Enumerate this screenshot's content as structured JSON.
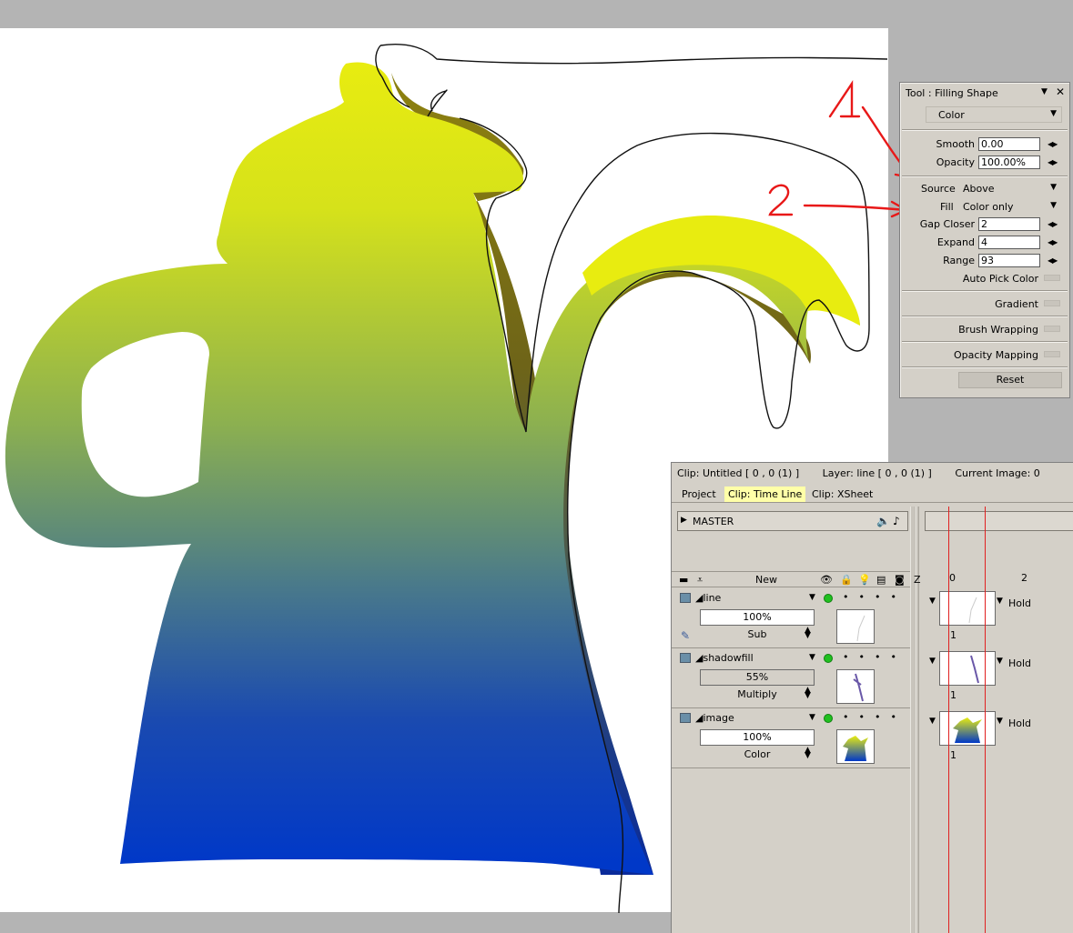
{
  "tool_panel": {
    "title": "Tool : Filling Shape",
    "mode_select": "Color",
    "fields": [
      {
        "label": "Smooth",
        "value": "0.00"
      },
      {
        "label": "Opacity",
        "value": "100.00%"
      }
    ],
    "source": {
      "label": "Source",
      "value": "Above"
    },
    "fill": {
      "label": "Fill",
      "value": "Color only"
    },
    "fields2": [
      {
        "label": "Gap Closer",
        "value": "2"
      },
      {
        "label": "Expand",
        "value": "4"
      },
      {
        "label": "Range",
        "value": "93"
      }
    ],
    "auto_pick": "Auto Pick Color",
    "sections": [
      "Gradient",
      "Brush Wrapping",
      "Opacity Mapping"
    ],
    "reset_label": "Reset"
  },
  "annotations": {
    "one": "1",
    "two": "2"
  },
  "timeline": {
    "clip_info": "Clip: Untitled [ 0 , 0  (1) ]",
    "layer_info": "Layer: line [ 0 , 0  (1) ]",
    "current_image": "Current Image: 0",
    "tabs": [
      "Project",
      "Clip: Time Line",
      "Clip: XSheet"
    ],
    "active_tab": 1,
    "master_label": "MASTER",
    "new_label": "New",
    "z_label": "Z",
    "ruler": [
      "0",
      "2"
    ],
    "layers": [
      {
        "name": "line",
        "opacity": "100%",
        "blend": "Sub",
        "frame_mode": "Hold",
        "frame_num": "1"
      },
      {
        "name": "shadowfill",
        "opacity": "55%",
        "blend": "Multiply",
        "frame_mode": "Hold",
        "frame_num": "1"
      },
      {
        "name": "image",
        "opacity": "100%",
        "blend": "Color",
        "frame_mode": "Hold",
        "frame_num": "1"
      }
    ]
  },
  "colors": {
    "pot_top": "#e8ec10",
    "pot_mid": "#8cb050",
    "pot_bottom": "#0038c8",
    "shadow": "#6e6418",
    "annotation_red": "#e81818",
    "panel_bg": "#d4d0c8",
    "active_tab": "#ffffa8"
  }
}
